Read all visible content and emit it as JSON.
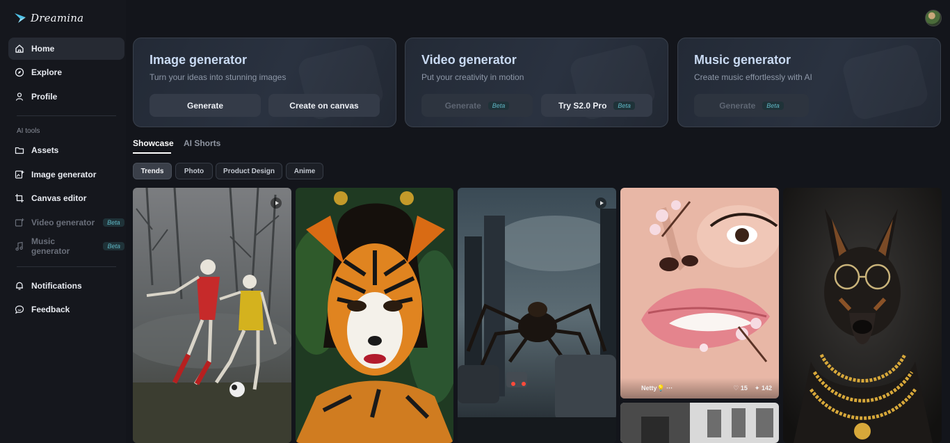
{
  "app": {
    "name": "Dreamina"
  },
  "sidebar": {
    "home": "Home",
    "explore": "Explore",
    "profile": "Profile",
    "section_label": "AI tools",
    "assets": "Assets",
    "image_generator": "Image generator",
    "canvas_editor": "Canvas editor",
    "video_generator": "Video generator",
    "music_generator": "Music generator",
    "beta": "Beta",
    "notifications": "Notifications",
    "feedback": "Feedback"
  },
  "cards": {
    "image": {
      "title": "Image generator",
      "subtitle": "Turn your ideas into stunning images",
      "btn1": "Generate",
      "btn2": "Create on canvas"
    },
    "video": {
      "title": "Video generator",
      "subtitle": "Put your creativity in motion",
      "btn1": "Generate",
      "btn2": "Try S2.0 Pro",
      "badge": "Beta"
    },
    "music": {
      "title": "Music generator",
      "subtitle": "Create music effortlessly with AI",
      "btn1": "Generate",
      "badge": "Beta"
    }
  },
  "tabs": {
    "showcase": "Showcase",
    "ai_shorts": "AI Shorts"
  },
  "chips": {
    "trends": "Trends",
    "photo": "Photo",
    "product_design": "Product Design",
    "anime": "Anime"
  },
  "gallery": {
    "tile4": {
      "author": "Netty💡 ···",
      "likes": "15",
      "remixes": "142"
    }
  },
  "colors": {
    "background": "#13151b",
    "sidebar": "#15171d",
    "card_title": "#c9daf2",
    "beta_text": "#5fb6c4"
  }
}
